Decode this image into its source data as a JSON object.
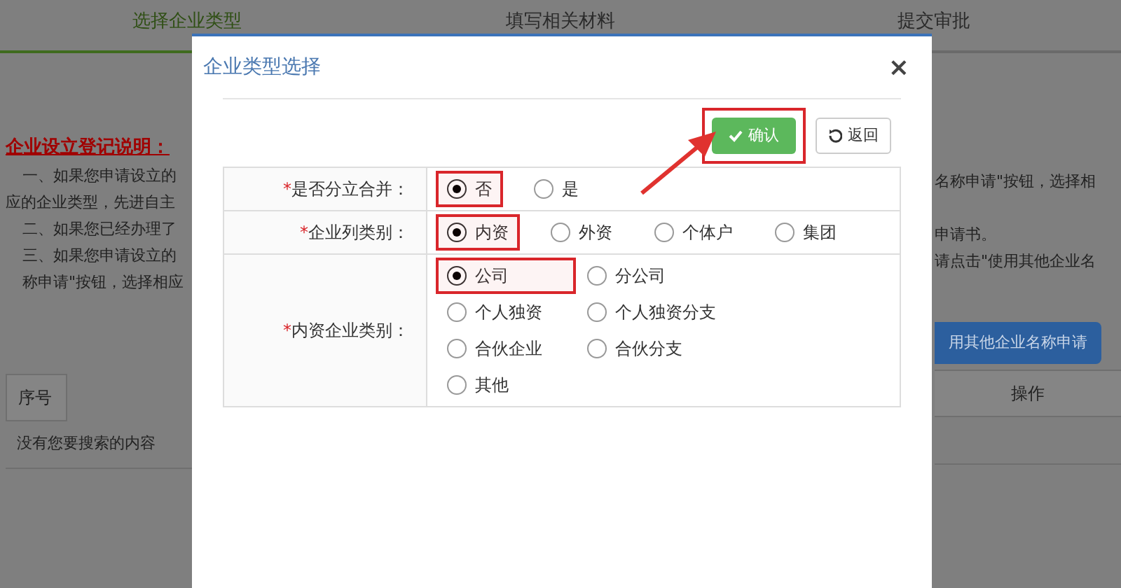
{
  "steps": [
    {
      "label": "选择企业类型",
      "active": true
    },
    {
      "label": "填写相关材料",
      "active": false
    },
    {
      "label": "提交审批",
      "active": false
    }
  ],
  "notes": {
    "title": "企业设立登记说明：",
    "left_lines": [
      "一、如果您申请设立的",
      "应的企业类型，先进自主",
      "二、如果您已经办理了",
      "三、如果您申请设立的",
      "称申请\"按钮，选择相应"
    ],
    "right_lines": [
      "名称申请\"按钮，选择相",
      "申请书。",
      "请点击\"使用其他企业名"
    ]
  },
  "other_name_button": "用其他企业名称申请",
  "table": {
    "columns": [
      "序号",
      "操作"
    ],
    "empty_message": "没有您要搜索的内容"
  },
  "dialog": {
    "title": "企业类型选择",
    "close": "×",
    "buttons": [
      {
        "kind": "primary",
        "label": "确认",
        "highlighted": true
      },
      {
        "kind": "default",
        "label": "返回",
        "highlighted": false
      }
    ],
    "fields": [
      {
        "required_mark": "*",
        "label": "是否分立合并：",
        "kind": "inline",
        "options": [
          {
            "label": "否",
            "selected": true,
            "highlighted": true
          },
          {
            "label": "是",
            "selected": false,
            "highlighted": false
          }
        ]
      },
      {
        "required_mark": "*",
        "label": "企业列类别：",
        "kind": "inline",
        "options": [
          {
            "label": "内资",
            "selected": true,
            "highlighted": true
          },
          {
            "label": "外资",
            "selected": false,
            "highlighted": false
          },
          {
            "label": "个体户",
            "selected": false,
            "highlighted": false
          },
          {
            "label": "集团",
            "selected": false,
            "highlighted": false
          }
        ]
      },
      {
        "required_mark": "*",
        "label": "内资企业类别：",
        "kind": "grid",
        "options": [
          {
            "label": "公司",
            "selected": true,
            "highlighted": true
          },
          {
            "label": "分公司",
            "selected": false,
            "highlighted": false
          },
          {
            "label": "个人独资",
            "selected": false,
            "highlighted": false
          },
          {
            "label": "个人独资分支",
            "selected": false,
            "highlighted": false
          },
          {
            "label": "合伙企业",
            "selected": false,
            "highlighted": false
          },
          {
            "label": "合伙分支",
            "selected": false,
            "highlighted": false
          },
          {
            "label": "其他",
            "selected": false,
            "highlighted": false
          }
        ]
      }
    ]
  }
}
